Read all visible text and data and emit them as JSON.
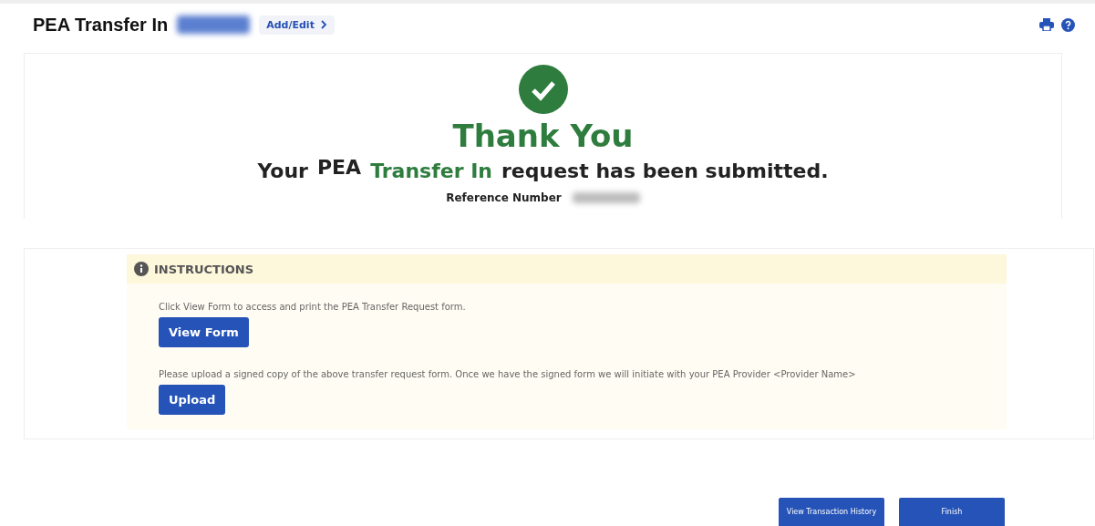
{
  "header": {
    "title": "PEA Transfer In",
    "account_redacted": true,
    "edit_link": "Add/Edit"
  },
  "confirmation": {
    "heading": "Thank You",
    "message": [
      {
        "kind": "plain",
        "text": "Your"
      },
      {
        "kind": "product",
        "text": "PEA"
      },
      {
        "kind": "highlight",
        "text": "Transfer In"
      },
      {
        "kind": "plain",
        "text": "request has been submitted."
      }
    ],
    "reference_label": "Reference Number",
    "reference_redacted": true
  },
  "instructions": {
    "title": "INSTRUCTIONS",
    "steps": [
      {
        "text": "Click View Form to access and print the PEA Transfer Request form.",
        "button": "View Form"
      },
      {
        "text": "Please upload a signed copy of the above transfer request form. Once we have the signed form we will initiate with your PEA Provider <Provider Name>",
        "button": "Upload"
      }
    ]
  },
  "footer_buttons": [
    "View Transaction History",
    "Finish"
  ]
}
